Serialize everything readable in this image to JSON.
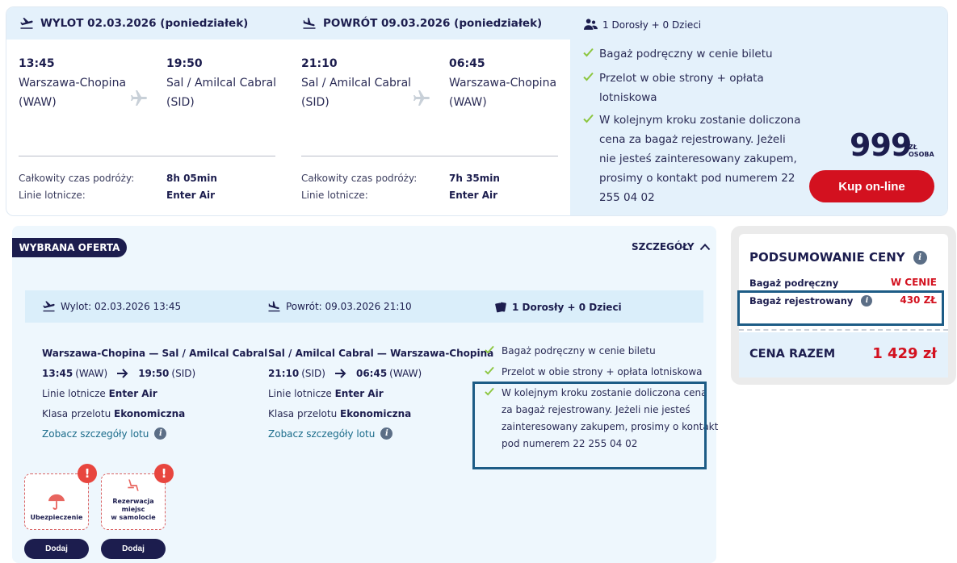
{
  "outbound": {
    "header": "WYLOT 02.03.2026 (poniedziałek)",
    "dep_time": "13:45",
    "dep_city": "Warszawa-Chopina",
    "dep_code": "(WAW)",
    "arr_time": "19:50",
    "arr_city": "Sal / Amilcal Cabral",
    "arr_code": "(SID)",
    "duration_label": "Całkowity czas podróży:",
    "duration": "8h 05min",
    "airline_label": "Linie lotnicze:",
    "airline": "Enter Air"
  },
  "return": {
    "header": "POWRÓT 09.03.2026 (poniedziałek)",
    "dep_time": "21:10",
    "dep_city": "Sal / Amilcal Cabral",
    "dep_code": "(SID)",
    "arr_time": "06:45",
    "arr_city": "Warszawa-Chopina",
    "arr_code": "(WAW)",
    "duration_label": "Całkowity czas podróży:",
    "duration": "7h 35min",
    "airline_label": "Linie lotnicze:",
    "airline": "Enter Air"
  },
  "passengers": "1 Dorosły + 0 Dzieci",
  "features": {
    "f1": "Bagaż podręczny w cenie biletu",
    "f2a": "Przelot w obie strony + opłata",
    "f2b": "lotniskowa",
    "f3a": "W kolejnym kroku zostanie doliczona",
    "f3b": "cena za bagaż rejestrowany. Jeżeli",
    "f3c": "nie jesteś zainteresowany zakupem,",
    "f3d": "prosimy o kontakt pod numerem 22",
    "f3e": "255 04 02"
  },
  "price": {
    "amount": "999",
    "unit_top": "ZŁ",
    "unit_bottom": "OSOBA",
    "buy_label": "Kup on-line"
  },
  "offer": {
    "badge": "WYBRANA OFERTA",
    "details_label": "SZCZEGÓŁY",
    "sub_out": "Wylot: 02.03.2026 13:45",
    "sub_ret": "Powrót: 09.03.2026 21:10",
    "sub_pax": "1 Dorosły + 0 Dzieci",
    "out_route": "Warszawa-Chopina — Sal / Amilcal Cabral",
    "out_dep_time": "13:45",
    "out_dep_code": "(WAW)",
    "out_arr_time": "19:50",
    "out_arr_code": "(SID)",
    "ret_route": "Sal / Amilcal Cabral — Warszawa-Chopina",
    "ret_dep_time": "21:10",
    "ret_dep_code": "(SID)",
    "ret_arr_time": "06:45",
    "ret_arr_code": "(WAW)",
    "airline_prefix": "Linie lotnicze",
    "airline": "Enter Air",
    "class_prefix": "Klasa przelotu",
    "class": "Ekonomiczna",
    "flight_details_link": "Zobacz szczegóły lotu",
    "c1": "Bagaż podręczny w cenie biletu",
    "c2": "Przelot w obie strony + opłata lotniskowa",
    "c3a": "W kolejnym kroku zostanie doliczona cena",
    "c3b": "za bagaż rejestrowany. Jeżeli nie jesteś",
    "c3c": "zainteresowany zakupem, prosimy o kontakt",
    "c3d": "pod numerem 22 255 04 02",
    "addon1": "Ubezpieczenie",
    "addon2a": "Rezerwacja miejsc",
    "addon2b": "w samolocie",
    "add_label": "Dodaj",
    "excl": "!"
  },
  "summary": {
    "title": "PODSUMOWANIE CENY",
    "row1_label": "Bagaż podręczny",
    "row1_value": "W CENIE",
    "row2_label": "Bagaż rejestrowany",
    "row2_value": "430 ZŁ",
    "total_label": "CENA RAZEM",
    "total_value": "1 429 zł"
  },
  "colors": {
    "navy": "#1c1d4e",
    "red": "#d3111f",
    "light_blue": "#e4f1fb",
    "check_green": "#8cc63f",
    "highlight": "#1d5c86"
  }
}
